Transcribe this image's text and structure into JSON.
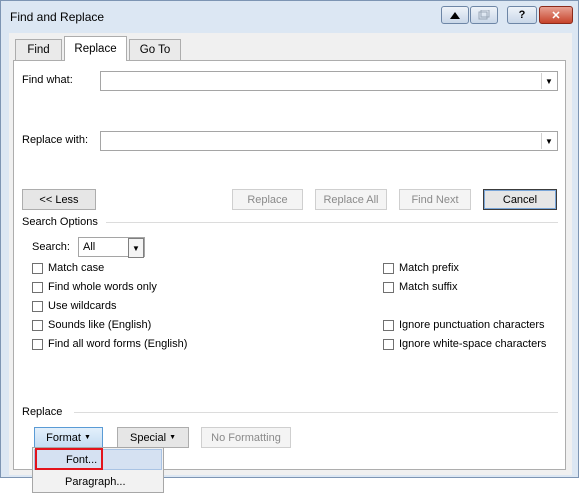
{
  "window": {
    "title": "Find and Replace",
    "help_label": "?",
    "close_label": "✕"
  },
  "tabs": [
    {
      "label": "Find",
      "accel": "d"
    },
    {
      "label": "Replace",
      "accel": "p"
    },
    {
      "label": "Go To",
      "accel": "G"
    }
  ],
  "find": {
    "label": "Find what:",
    "value": ""
  },
  "replace": {
    "label": "Replace with:",
    "value": ""
  },
  "buttons": {
    "less": "<< Less",
    "replace": "Replace",
    "replace_all": "Replace All",
    "find_next": "Find Next",
    "cancel": "Cancel"
  },
  "search_options": {
    "heading": "Search Options",
    "search_label": "Search:",
    "search_value": "All",
    "left": [
      {
        "label": "Match case",
        "checked": false
      },
      {
        "label": "Find whole words only",
        "checked": false
      },
      {
        "label": "Use wildcards",
        "checked": false
      },
      {
        "label": "Sounds like (English)",
        "checked": false
      },
      {
        "label": "Find all word forms (English)",
        "checked": false
      }
    ],
    "right": [
      {
        "label": "Match prefix",
        "checked": false
      },
      {
        "label": "Match suffix",
        "checked": false
      },
      {
        "label": "Ignore punctuation characters",
        "checked": false
      },
      {
        "label": "Ignore white-space characters",
        "checked": false
      }
    ]
  },
  "replace_section": {
    "heading": "Replace",
    "format_label": "Format",
    "special_label": "Special",
    "no_formatting_label": "No Formatting"
  },
  "format_menu": [
    {
      "label": "Font...",
      "highlighted": true
    },
    {
      "label": "Paragraph...",
      "highlighted": false
    }
  ],
  "colors": {
    "highlight_box": "#e3141d",
    "title_bar": "#dce7f3"
  }
}
